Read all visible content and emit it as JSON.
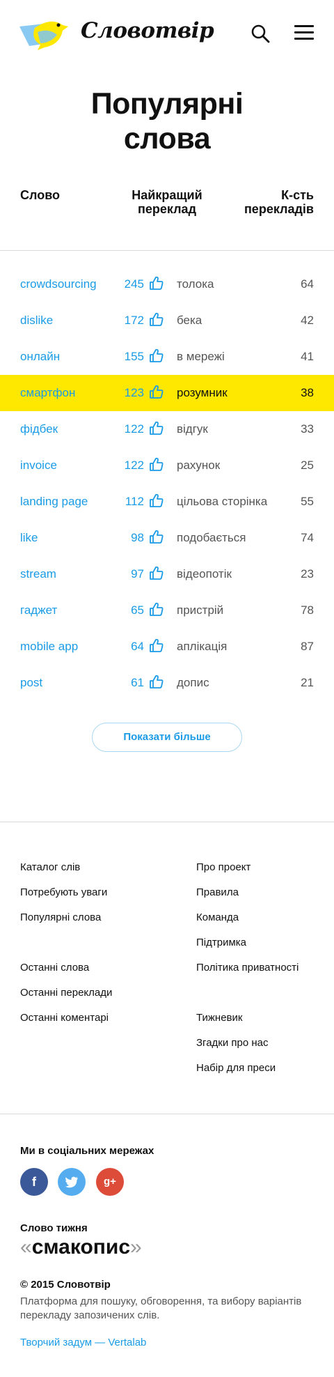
{
  "header": {
    "brand": "Словотвір"
  },
  "page_title": {
    "line1": "Популярні",
    "line2": "слова"
  },
  "table": {
    "col_word": "Слово",
    "col_best_line1": "Найкращий",
    "col_best_line2": "переклад",
    "col_count_line1": "К-сть",
    "col_count_line2": "перекладів",
    "rows": [
      {
        "word": "crowdsourcing",
        "votes": "245",
        "translation": "толока",
        "count": "64"
      },
      {
        "word": "dislike",
        "votes": "172",
        "translation": "бека",
        "count": "42"
      },
      {
        "word": "онлайн",
        "votes": "155",
        "translation": "в мережі",
        "count": "41"
      },
      {
        "word": "смартфон",
        "votes": "123",
        "translation": "розумник",
        "count": "38"
      },
      {
        "word": "фідбек",
        "votes": "122",
        "translation": "відгук",
        "count": "33"
      },
      {
        "word": "invoice",
        "votes": "122",
        "translation": "рахунок",
        "count": "25"
      },
      {
        "word": "landing page",
        "votes": "112",
        "translation": "цільова сторінка",
        "count": "55"
      },
      {
        "word": "like",
        "votes": "98",
        "translation": "подобається",
        "count": "74"
      },
      {
        "word": "stream",
        "votes": "97",
        "translation": "відеопотік",
        "count": "23"
      },
      {
        "word": "гаджет",
        "votes": "65",
        "translation": "пристрій",
        "count": "78"
      },
      {
        "word": "mobile app",
        "votes": "64",
        "translation": "аплікація",
        "count": "87"
      },
      {
        "word": "post",
        "votes": "61",
        "translation": "допис",
        "count": "21"
      }
    ]
  },
  "show_more": "Показати більше",
  "footer": {
    "left": [
      "Каталог слів",
      "Потребують уваги",
      "Популярні слова",
      "Останні слова",
      "Останні переклади",
      "Останні коментарі"
    ],
    "right": [
      "Про проект",
      "Правила",
      "Команда",
      "Підтримка",
      "Політика приватності",
      "Тижневик",
      "Згадки про нас",
      "Набір для преси"
    ],
    "social_title": "Ми в соціальних мережах",
    "social": {
      "facebook": "f",
      "google": "g+"
    },
    "word_of_week_label": "Слово тижня",
    "word_of_week": "смакопис",
    "quote_open": "«",
    "quote_close": "»",
    "copyright": "© 2015 Словотвір",
    "description": "Платформа для пошуку, обговорення, та вибору варіантів перекладу запозичених слів.",
    "credit": "Творчий задум — Vertalab"
  },
  "colors": {
    "accent": "#1a9be6",
    "highlight": "#ffe800",
    "facebook": "#3b5998",
    "twitter": "#55acee",
    "google": "#dd4b39"
  },
  "icons": [
    "bird-logo-icon",
    "search-icon",
    "hamburger-menu-icon",
    "thumbs-up-icon",
    "facebook-icon",
    "twitter-icon",
    "google-plus-icon"
  ]
}
